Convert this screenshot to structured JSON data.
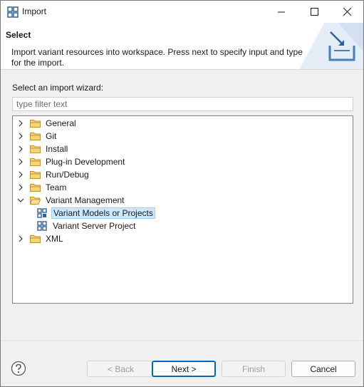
{
  "window": {
    "title": "Import"
  },
  "banner": {
    "title": "Select",
    "description": "Import variant resources into workspace. Press next to specify input and type for the import."
  },
  "wizard": {
    "label": "Select an import wizard:",
    "filter_placeholder": "type filter text",
    "filter_value": ""
  },
  "tree": {
    "items": [
      {
        "label": "General",
        "type": "folder",
        "expanded": false
      },
      {
        "label": "Git",
        "type": "folder",
        "expanded": false
      },
      {
        "label": "Install",
        "type": "folder",
        "expanded": false
      },
      {
        "label": "Plug-in Development",
        "type": "folder",
        "expanded": false
      },
      {
        "label": "Run/Debug",
        "type": "folder",
        "expanded": false
      },
      {
        "label": "Team",
        "type": "folder",
        "expanded": false
      },
      {
        "label": "Variant Management",
        "type": "folder",
        "expanded": true
      },
      {
        "label": "Variant Models or Projects",
        "type": "wizard",
        "selected": true
      },
      {
        "label": "Variant Server Project",
        "type": "wizard",
        "selected": false
      },
      {
        "label": "XML",
        "type": "folder",
        "expanded": false
      }
    ]
  },
  "buttons": {
    "back": "< Back",
    "next": "Next >",
    "finish": "Finish",
    "cancel": "Cancel"
  },
  "colors": {
    "selection_bg": "#cce8ff",
    "selection_border": "#99d1ff",
    "folder": "#e8b04a",
    "default_button_border": "#0067c0",
    "icon_blue": "#2f5f9e"
  }
}
